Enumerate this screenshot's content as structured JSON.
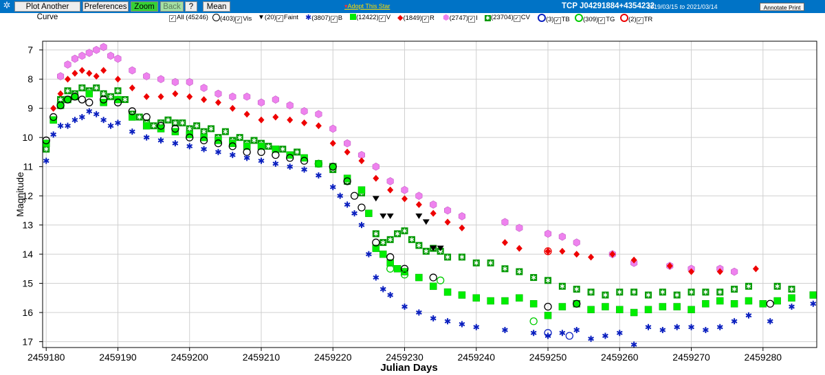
{
  "toolbar": {
    "buttons": [
      "Plot Another Curve",
      "Preferences",
      "Zoom",
      "Back",
      "?",
      "Mean"
    ],
    "adopt_label": "Adopt This Star",
    "star_name": "TCP J04291884+4354232",
    "date_from": "2019/03/15",
    "date_to_word": "to",
    "date_to": "2021/03/14",
    "annotate_label": "Annotate Print"
  },
  "legend": [
    {
      "count": "All (45246)",
      "name": ""
    },
    {
      "count": "(403)",
      "name": "Vis",
      "color": "#000000",
      "icon": "open-circle-icon"
    },
    {
      "count": "(20)",
      "name": "Faint",
      "color": "#000000",
      "icon": "triangle-down-icon"
    },
    {
      "count": "(3807)",
      "name": "B",
      "color": "#0a1fbf",
      "icon": "star-icon"
    },
    {
      "count": "(12422)",
      "name": "V",
      "color": "#00ee00",
      "icon": "square-icon"
    },
    {
      "count": "(1849)",
      "name": "R",
      "color": "#ee0000",
      "icon": "diamond-icon"
    },
    {
      "count": "(2747)",
      "name": "I",
      "color": "#ee82ee",
      "icon": "hexagon-icon"
    },
    {
      "count": "(23704)",
      "name": "CV",
      "color": "#009900",
      "icon": "square-star-icon"
    },
    {
      "count": "(3)",
      "name": "TB",
      "color": "#0a1fbf",
      "icon": "open-circle-icon"
    },
    {
      "count": "(309)",
      "name": "TG",
      "color": "#00cc00",
      "icon": "open-circle-icon"
    },
    {
      "count": "(2)",
      "name": "TR",
      "color": "#ee0000",
      "icon": "open-circle-icon"
    }
  ],
  "chart_data": {
    "type": "scatter",
    "xlabel": "Julian Days",
    "ylabel": "Magnitude",
    "xlim": [
      2459179.5,
      2459287.5
    ],
    "ylim": [
      6.7,
      17.2
    ],
    "y_inverted": true,
    "grid": true,
    "x_ticks": [
      2459180,
      2459190,
      2459200,
      2459210,
      2459220,
      2459230,
      2459240,
      2459250,
      2459260,
      2459270,
      2459280
    ],
    "y_ticks": [
      7,
      8,
      9,
      10,
      11,
      12,
      13,
      14,
      15,
      16,
      17
    ],
    "series": [
      {
        "name": "I",
        "color": "#ee82ee",
        "marker": "hexagon",
        "x": [
          2459182,
          2459183,
          2459184,
          2459185,
          2459186,
          2459187,
          2459188,
          2459189,
          2459190,
          2459192,
          2459194,
          2459196,
          2459198,
          2459200,
          2459202,
          2459204,
          2459206,
          2459208,
          2459210,
          2459212,
          2459214,
          2459216,
          2459218,
          2459220,
          2459222,
          2459224,
          2459226,
          2459228,
          2459230,
          2459232,
          2459234,
          2459236,
          2459238,
          2459244,
          2459246,
          2459250,
          2459252,
          2459254,
          2459259,
          2459262,
          2459267,
          2459270,
          2459274,
          2459276
        ],
        "y": [
          7.9,
          7.5,
          7.3,
          7.2,
          7.1,
          7.0,
          6.9,
          7.2,
          7.3,
          7.7,
          7.9,
          8.0,
          8.1,
          8.1,
          8.3,
          8.5,
          8.6,
          8.6,
          8.8,
          8.7,
          8.9,
          9.1,
          9.2,
          9.7,
          10.2,
          10.6,
          11.0,
          11.5,
          11.8,
          12.0,
          12.3,
          12.5,
          12.7,
          12.9,
          13.1,
          13.3,
          13.4,
          13.6,
          14.0,
          14.3,
          14.4,
          14.5,
          14.5,
          14.6
        ]
      },
      {
        "name": "R",
        "color": "#ee0000",
        "marker": "diamond",
        "x": [
          2459181,
          2459182,
          2459183,
          2459184,
          2459185,
          2459186,
          2459187,
          2459188,
          2459190,
          2459192,
          2459194,
          2459196,
          2459198,
          2459200,
          2459202,
          2459204,
          2459206,
          2459208,
          2459210,
          2459212,
          2459214,
          2459216,
          2459218,
          2459220,
          2459222,
          2459224,
          2459226,
          2459228,
          2459230,
          2459232,
          2459234,
          2459236,
          2459238,
          2459244,
          2459246,
          2459250,
          2459252,
          2459254,
          2459256,
          2459259,
          2459262,
          2459267,
          2459270,
          2459274,
          2459279
        ],
        "y": [
          9.0,
          8.5,
          8.0,
          7.8,
          7.7,
          7.8,
          7.9,
          7.7,
          8.0,
          8.3,
          8.6,
          8.6,
          8.5,
          8.6,
          8.7,
          8.8,
          9.0,
          9.2,
          9.4,
          9.3,
          9.4,
          9.5,
          9.6,
          10.2,
          10.5,
          10.8,
          11.4,
          11.8,
          12.1,
          12.3,
          12.6,
          12.9,
          13.1,
          13.6,
          13.8,
          13.9,
          13.9,
          14.0,
          14.1,
          14.0,
          14.2,
          14.4,
          14.6,
          14.6,
          14.5
        ]
      },
      {
        "name": "CV",
        "color": "#009900",
        "marker": "square-star",
        "x": [
          2459180,
          2459181,
          2459182,
          2459183,
          2459184,
          2459185,
          2459186,
          2459187,
          2459188,
          2459189,
          2459190,
          2459191,
          2459192,
          2459193,
          2459194,
          2459195,
          2459196,
          2459197,
          2459198,
          2459199,
          2459200,
          2459201,
          2459202,
          2459203,
          2459204,
          2459205,
          2459206,
          2459207,
          2459208,
          2459209,
          2459210,
          2459211,
          2459212,
          2459213,
          2459214,
          2459215,
          2459216,
          2459218,
          2459220,
          2459222,
          2459224,
          2459226,
          2459227,
          2459228,
          2459229,
          2459230,
          2459231,
          2459232,
          2459233,
          2459234,
          2459235,
          2459236,
          2459238,
          2459240,
          2459242,
          2459244,
          2459246,
          2459248,
          2459250,
          2459252,
          2459254,
          2459256,
          2459258,
          2459260,
          2459262,
          2459264,
          2459266,
          2459268,
          2459270,
          2459272,
          2459274,
          2459276,
          2459278,
          2459282,
          2459284
        ],
        "y": [
          10.4,
          9.4,
          8.7,
          8.4,
          8.5,
          8.3,
          8.4,
          8.3,
          8.5,
          8.6,
          8.4,
          8.7,
          9.2,
          9.3,
          9.5,
          9.6,
          9.5,
          9.4,
          9.5,
          9.5,
          9.7,
          9.6,
          9.8,
          9.7,
          10.0,
          9.8,
          10.1,
          10.0,
          10.2,
          10.1,
          10.2,
          10.3,
          10.4,
          10.4,
          10.6,
          10.5,
          10.7,
          10.9,
          11.1,
          11.5,
          11.9,
          13.3,
          13.6,
          13.5,
          13.3,
          13.2,
          13.5,
          13.7,
          13.9,
          13.8,
          13.9,
          14.1,
          14.1,
          14.3,
          14.3,
          14.5,
          14.6,
          14.8,
          14.9,
          15.1,
          15.2,
          15.3,
          15.4,
          15.3,
          15.3,
          15.4,
          15.3,
          15.4,
          15.3,
          15.3,
          15.3,
          15.2,
          15.1,
          15.1,
          15.2
        ]
      },
      {
        "name": "V",
        "color": "#00ee00",
        "marker": "square",
        "x": [
          2459180,
          2459181,
          2459182,
          2459183,
          2459184,
          2459186,
          2459188,
          2459190,
          2459192,
          2459194,
          2459196,
          2459198,
          2459200,
          2459202,
          2459204,
          2459206,
          2459208,
          2459210,
          2459212,
          2459214,
          2459216,
          2459218,
          2459220,
          2459222,
          2459224,
          2459225,
          2459226,
          2459227,
          2459228,
          2459229,
          2459230,
          2459232,
          2459234,
          2459236,
          2459238,
          2459240,
          2459242,
          2459244,
          2459246,
          2459248,
          2459250,
          2459252,
          2459254,
          2459256,
          2459258,
          2459260,
          2459262,
          2459264,
          2459266,
          2459268,
          2459270,
          2459272,
          2459274,
          2459276,
          2459278,
          2459280,
          2459282,
          2459284,
          2459287
        ],
        "y": [
          10.2,
          9.4,
          8.9,
          8.7,
          8.6,
          8.5,
          8.8,
          8.7,
          9.3,
          9.6,
          9.7,
          9.8,
          9.9,
          10.0,
          10.1,
          10.2,
          10.3,
          10.3,
          10.4,
          10.6,
          10.7,
          10.9,
          11.0,
          11.4,
          11.8,
          12.6,
          13.8,
          14.0,
          14.3,
          14.5,
          14.6,
          14.8,
          15.1,
          15.3,
          15.4,
          15.5,
          15.6,
          15.6,
          15.5,
          15.7,
          16.1,
          15.8,
          15.7,
          15.9,
          15.8,
          15.9,
          16.0,
          15.9,
          15.8,
          15.8,
          15.9,
          15.7,
          15.6,
          15.7,
          15.6,
          15.7,
          15.6,
          15.5,
          15.4
        ]
      },
      {
        "name": "Vis",
        "color": "#000000",
        "marker": "open-circle",
        "x": [
          2459180,
          2459181,
          2459182,
          2459183,
          2459184,
          2459185,
          2459186,
          2459188,
          2459190,
          2459192,
          2459194,
          2459196,
          2459198,
          2459200,
          2459202,
          2459204,
          2459206,
          2459208,
          2459210,
          2459212,
          2459214,
          2459216,
          2459218,
          2459220,
          2459222,
          2459223,
          2459224,
          2459226,
          2459228,
          2459230,
          2459234,
          2459250,
          2459254,
          2459281
        ],
        "y": [
          10.1,
          9.3,
          8.9,
          8.7,
          8.6,
          8.7,
          8.8,
          8.7,
          8.8,
          9.1,
          9.3,
          9.6,
          9.7,
          10.0,
          10.1,
          10.2,
          10.3,
          10.5,
          10.5,
          10.6,
          10.7,
          10.8,
          10.9,
          11.0,
          11.5,
          12.0,
          12.4,
          13.6,
          14.1,
          14.5,
          14.8,
          15.8,
          15.7,
          15.7
        ]
      },
      {
        "name": "Faint",
        "color": "#000000",
        "marker": "triangle-down",
        "x": [
          2459226,
          2459227,
          2459228,
          2459232,
          2459233,
          2459234,
          2459235
        ],
        "y": [
          12.1,
          12.7,
          12.7,
          12.7,
          12.9,
          13.8,
          13.8
        ]
      },
      {
        "name": "B",
        "color": "#0a1fbf",
        "marker": "star",
        "x": [
          2459180,
          2459181,
          2459182,
          2459183,
          2459184,
          2459185,
          2459186,
          2459187,
          2459188,
          2459189,
          2459190,
          2459192,
          2459194,
          2459196,
          2459198,
          2459200,
          2459202,
          2459204,
          2459206,
          2459208,
          2459210,
          2459212,
          2459214,
          2459216,
          2459218,
          2459220,
          2459221,
          2459222,
          2459223,
          2459224,
          2459225,
          2459226,
          2459227,
          2459228,
          2459230,
          2459232,
          2459234,
          2459236,
          2459238,
          2459240,
          2459244,
          2459248,
          2459250,
          2459252,
          2459254,
          2459256,
          2459258,
          2459260,
          2459262,
          2459264,
          2459266,
          2459268,
          2459270,
          2459272,
          2459274,
          2459276,
          2459278,
          2459281,
          2459284,
          2459287
        ],
        "y": [
          10.8,
          9.9,
          9.6,
          9.6,
          9.4,
          9.3,
          9.1,
          9.2,
          9.4,
          9.6,
          9.5,
          9.8,
          10.0,
          10.1,
          10.2,
          10.3,
          10.4,
          10.5,
          10.6,
          10.7,
          10.8,
          10.9,
          11.0,
          11.1,
          11.3,
          11.7,
          12.0,
          12.3,
          12.6,
          13.0,
          14.0,
          14.8,
          15.2,
          15.4,
          15.8,
          16.0,
          16.2,
          16.3,
          16.4,
          16.5,
          16.6,
          16.7,
          16.8,
          16.7,
          16.6,
          16.9,
          16.8,
          16.7,
          17.1,
          16.5,
          16.6,
          16.5,
          16.5,
          16.6,
          16.5,
          16.3,
          16.1,
          16.3,
          15.8,
          15.7
        ]
      },
      {
        "name": "TG",
        "color": "#00cc00",
        "marker": "open-circle",
        "x": [
          2459218,
          2459228,
          2459230,
          2459235,
          2459248
        ],
        "y": [
          10.9,
          14.5,
          14.7,
          14.9,
          16.3
        ]
      },
      {
        "name": "TB",
        "color": "#0a1fbf",
        "marker": "open-circle",
        "x": [
          2459250,
          2459253
        ],
        "y": [
          16.7,
          16.8
        ]
      },
      {
        "name": "TR",
        "color": "#ee0000",
        "marker": "open-circle",
        "x": [
          2459250
        ],
        "y": [
          13.9
        ]
      }
    ]
  }
}
